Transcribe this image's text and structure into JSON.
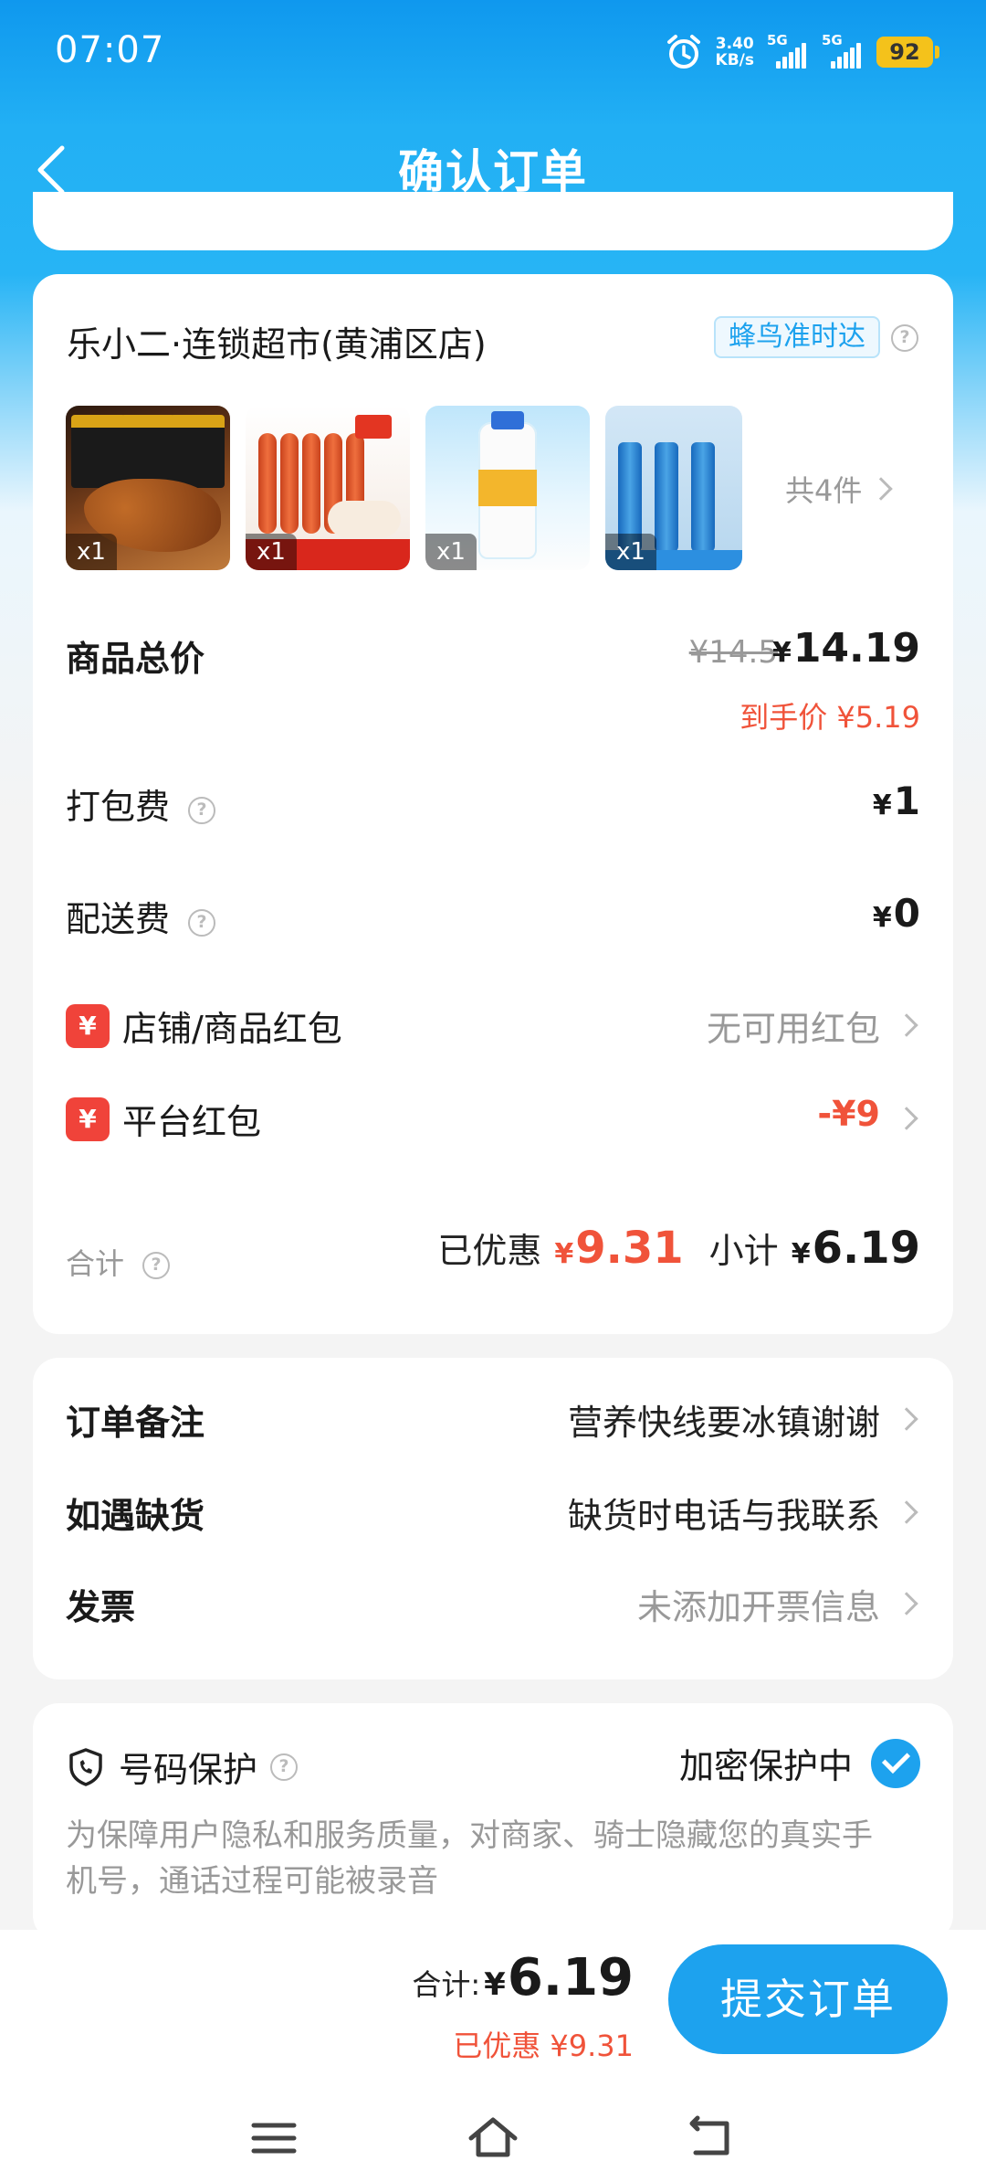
{
  "status_bar": {
    "time": "07:07",
    "net_speed_value": "3.40",
    "net_speed_unit": "KB/s",
    "signal_1": "5G",
    "signal_2": "5G",
    "battery": "92"
  },
  "header": {
    "title": "确认订单"
  },
  "store": {
    "name": "乐小二·连锁超市(黄浦区店)",
    "delivery_badge": "蜂鸟准时达",
    "items": [
      {
        "qty": "x1",
        "icon": "spicy-snack-product"
      },
      {
        "qty": "x1",
        "icon": "sausage-product"
      },
      {
        "qty": "x1",
        "icon": "yogurt-drink-product"
      },
      {
        "qty": "x1",
        "icon": "spray-product"
      }
    ],
    "items_count": "共4件"
  },
  "pricing": {
    "goods_total_label": "商品总价",
    "original_price": "¥14.5",
    "current_price_yen": "¥",
    "current_price": "14.19",
    "final_price": "到手价 ¥5.19",
    "packing_fee_label": "打包费",
    "packing_fee_yen": "¥",
    "packing_fee": "1",
    "delivery_fee_label": "配送费",
    "delivery_fee_yen": "¥",
    "delivery_fee": "0",
    "store_red_packet_label": "店铺/商品红包",
    "store_red_packet_value": "无可用红包",
    "platform_red_packet_label": "平台红包",
    "platform_red_packet_value": "-¥9",
    "red_packet_icon": "¥",
    "summary_label": "合计",
    "discounted_label": "已优惠",
    "discounted_yen": "¥",
    "discounted_value": "9.31",
    "subtotal_label": "小计",
    "subtotal_yen": "¥",
    "subtotal_value": "6.19"
  },
  "order_options": [
    {
      "label": "订单备注",
      "value": "营养快线要冰镇谢谢"
    },
    {
      "label": "如遇缺货",
      "value": "缺货时电话与我联系"
    },
    {
      "label": "发票",
      "value": "未添加开票信息"
    }
  ],
  "privacy": {
    "title": "号码保护",
    "status": "加密保护中",
    "description": "为保障用户隐私和服务质量，对商家、骑士隐藏您的真实手机号，通话过程可能被录音"
  },
  "bottom": {
    "total_label": "合计:",
    "total_yen": "¥",
    "total_value": "6.19",
    "discount_text": "已优惠 ¥9.31",
    "submit_label": "提交订单"
  },
  "colors": {
    "brand_blue": "#1da2ee",
    "discount_red": "#f0533a"
  }
}
